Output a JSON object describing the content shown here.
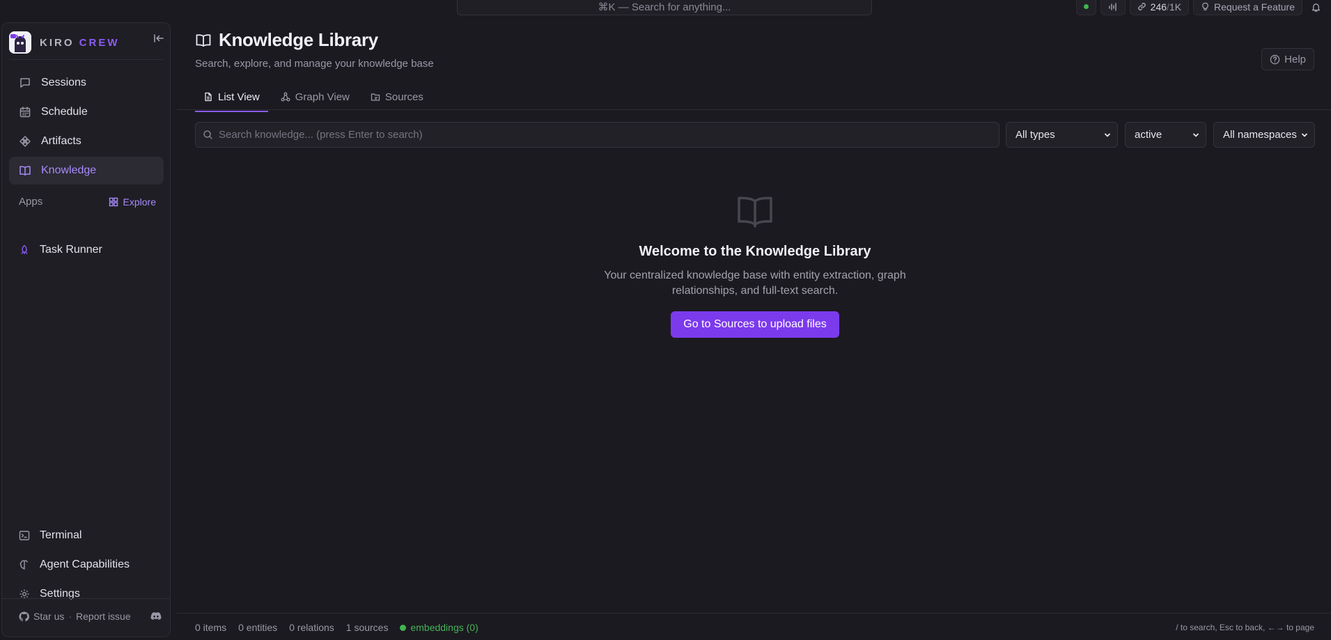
{
  "topbar": {
    "command_search": "⌘K — Search for anything...",
    "usage_used": "246",
    "usage_sep": "/",
    "usage_limit": "1K",
    "request_feature": "Request a Feature",
    "status_color": "#3fb550"
  },
  "sidebar": {
    "brand_part1": "KIRO",
    "brand_part2": "CREW",
    "nav": [
      {
        "label": "Sessions",
        "icon": "chat-bubble-icon"
      },
      {
        "label": "Schedule",
        "icon": "calendar-icon"
      },
      {
        "label": "Artifacts",
        "icon": "shapes-icon"
      },
      {
        "label": "Knowledge",
        "icon": "book-open-icon",
        "active": true
      }
    ],
    "apps_label": "Apps",
    "explore_label": "Explore",
    "apps": [
      {
        "label": "Task Runner",
        "icon": "rocket-icon"
      }
    ],
    "bottom_nav": [
      {
        "label": "Terminal",
        "icon": "terminal-icon"
      },
      {
        "label": "Agent Capabilities",
        "icon": "brain-icon"
      },
      {
        "label": "Settings",
        "icon": "gear-icon"
      }
    ],
    "footer": {
      "star": "Star us",
      "separator": "·",
      "report": "Report issue"
    }
  },
  "main": {
    "title": "Knowledge Library",
    "subtitle": "Search, explore, and manage your knowledge base",
    "help": "Help",
    "tabs": [
      {
        "label": "List View",
        "active": true
      },
      {
        "label": "Graph View"
      },
      {
        "label": "Sources"
      }
    ],
    "search_placeholder": "Search knowledge... (press Enter to search)",
    "filters": {
      "type": "All types",
      "status": "active",
      "namespace": "All namespaces"
    },
    "empty": {
      "title": "Welcome to the Knowledge Library",
      "description": "Your centralized knowledge base with entity extraction, graph relationships, and full-text search.",
      "cta": "Go to Sources to upload files"
    },
    "status": {
      "items": "0 items",
      "entities": "0 entities",
      "relations": "0 relations",
      "sources": "1 sources",
      "embeddings": "embeddings (0)",
      "hint": "/ to search, Esc to back, ←→ to page"
    }
  },
  "colors": {
    "accent": "#8b5cf6",
    "button": "#7c3aed",
    "background": "#1b1a20",
    "sidebar": "#1f1e24",
    "success": "#3fb550"
  }
}
